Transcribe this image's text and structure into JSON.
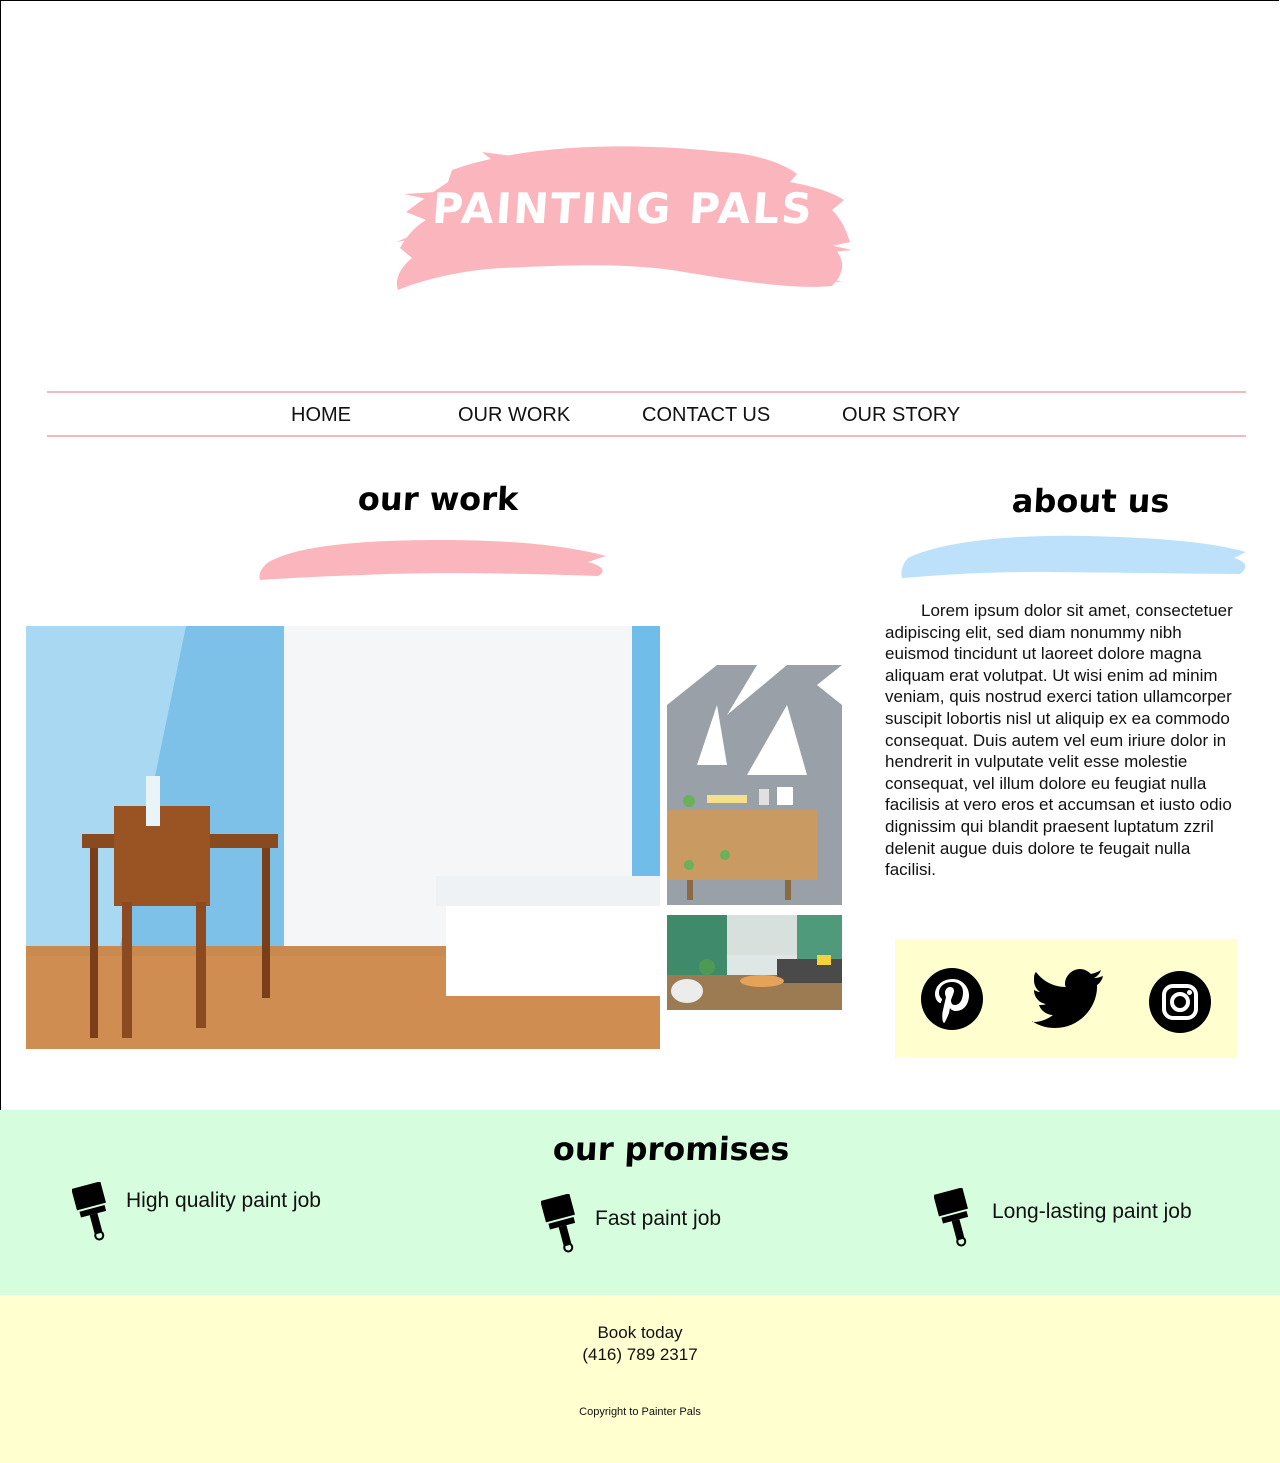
{
  "brand": {
    "logo_text": "PAINTING PALS"
  },
  "nav": {
    "items": [
      {
        "label": "HOME"
      },
      {
        "label": "OUR WORK"
      },
      {
        "label": "CONTACT US"
      },
      {
        "label": "OUR STORY"
      }
    ]
  },
  "our_work": {
    "title": "our work"
  },
  "about": {
    "title": "about us",
    "body": "Lorem ipsum dolor sit amet, consectetuer adipiscing elit, sed diam nonummy nibh euismod tincidunt ut laoreet dolore magna aliquam erat volutpat. Ut wisi enim ad minim veniam, quis nostrud exerci tation ullamcorper suscipit lobortis nisl ut aliquip ex ea commodo consequat. Duis autem vel eum iriure dolor in hendrerit in vulputate velit esse molestie consequat, vel illum dolore eu feugiat nulla facilisis at vero eros et accumsan et iusto odio dignissim qui blandit praesent luptatum zzril delenit augue duis dolore te feugait nulla facilisi."
  },
  "social": {
    "icons": [
      "pinterest-icon",
      "twitter-icon",
      "instagram-icon"
    ]
  },
  "promises": {
    "title": "our promises",
    "items": [
      {
        "label": "High quality paint job",
        "icon": "paintbrush-icon"
      },
      {
        "label": "Fast paint job",
        "icon": "paintbrush-icon"
      },
      {
        "label": "Long-lasting paint job",
        "icon": "paintbrush-icon"
      }
    ]
  },
  "footer": {
    "cta": "Book today",
    "phone": "(416) 789 2317",
    "copyright": "Copyright to Painter Pals"
  },
  "colors": {
    "pink": "#fbb6bd",
    "blue": "#bde1fb",
    "mint": "#d6fddd",
    "cream": "#ffffcf"
  }
}
